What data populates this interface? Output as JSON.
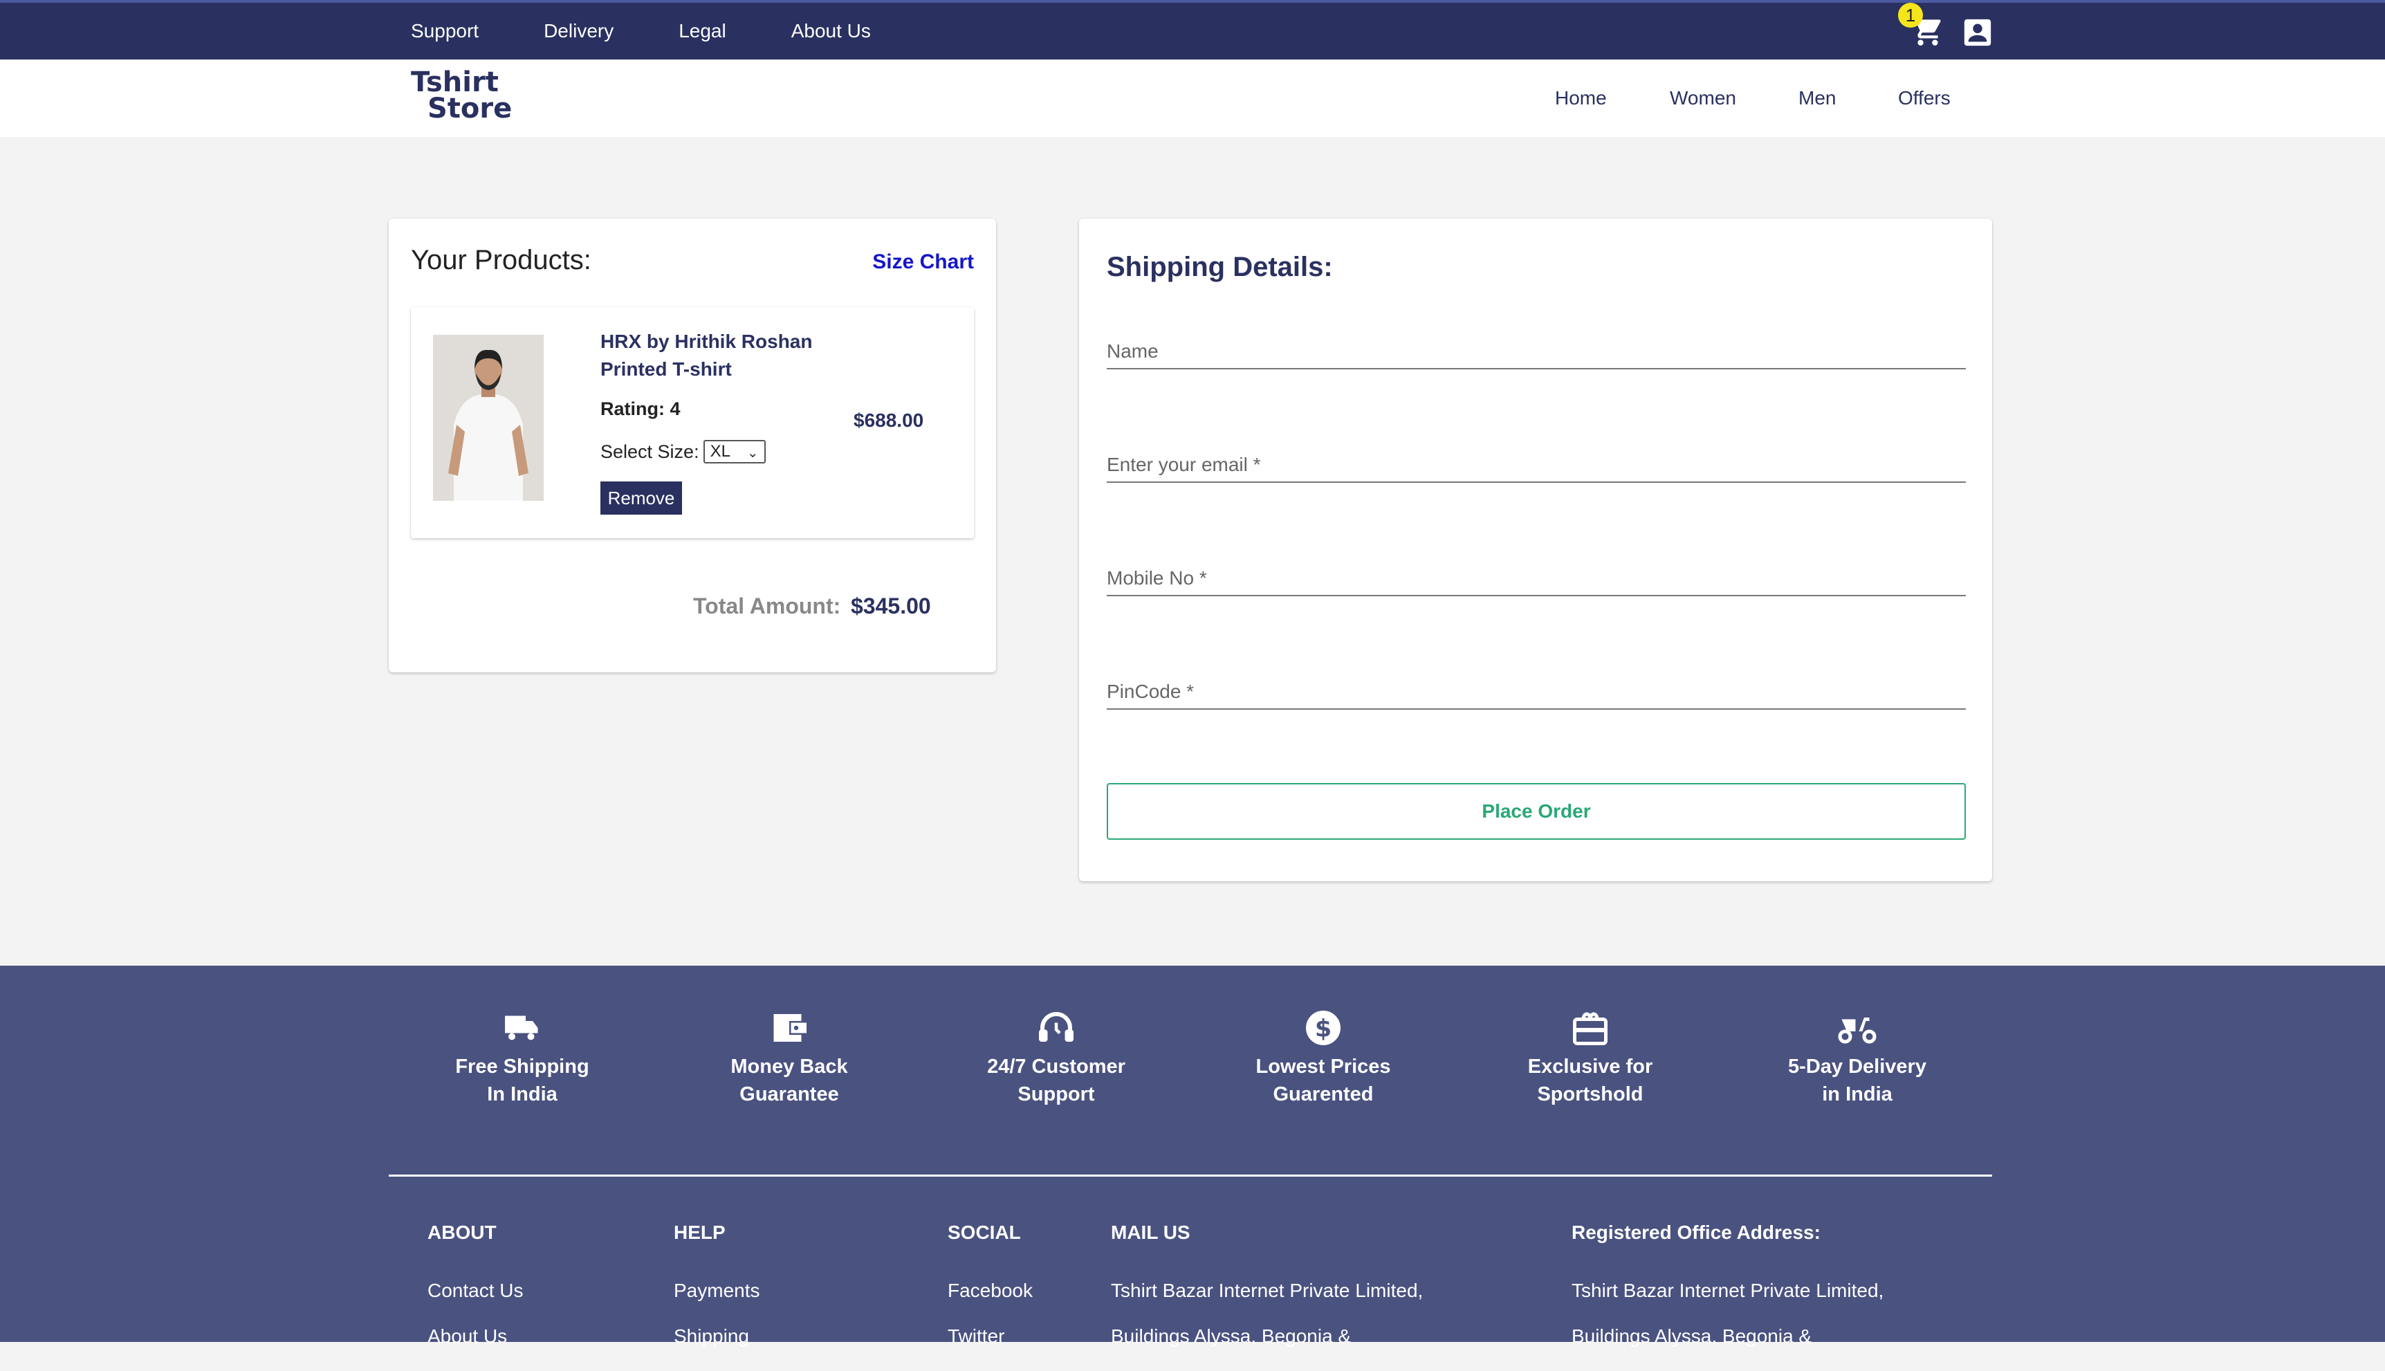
{
  "topbar": {
    "links": [
      "Support",
      "Delivery",
      "Legal",
      "About Us"
    ],
    "cart_count": "1",
    "cart_icon": "cart-icon",
    "account_icon": "account-icon"
  },
  "navbar": {
    "logo_line1": "Tshirt",
    "logo_line2": "Store",
    "links": [
      "Home",
      "Women",
      "Men",
      "Offers"
    ]
  },
  "products": {
    "title": "Your Products:",
    "size_chart": "Size Chart",
    "items": [
      {
        "name": "HRX by Hrithik Roshan Printed T-shirt",
        "rating_label": "Rating: 4",
        "size_label": "Select Size:",
        "size_value": "XL",
        "remove_label": "Remove",
        "price": "$688.00"
      }
    ],
    "total_label": "Total Amount:",
    "total_value": "$345.00"
  },
  "shipping": {
    "title": "Shipping Details:",
    "fields": [
      {
        "placeholder": "Name"
      },
      {
        "placeholder": "Enter your email *"
      },
      {
        "placeholder": "Mobile No *"
      },
      {
        "placeholder": "PinCode *"
      }
    ],
    "place_order": "Place Order"
  },
  "footer": {
    "features": [
      {
        "icon": "truck-icon",
        "line1": "Free Shipping",
        "line2": "In India"
      },
      {
        "icon": "wallet-icon",
        "line1": "Money Back",
        "line2": "Guarantee"
      },
      {
        "icon": "headset-icon",
        "line1": "24/7 Customer",
        "line2": "Support"
      },
      {
        "icon": "dollar-icon",
        "line1": "Lowest Prices",
        "line2": "Guarented"
      },
      {
        "icon": "card-icon",
        "line1": "Exclusive for",
        "line2": "Sportshold"
      },
      {
        "icon": "scooter-icon",
        "line1": "5-Day Delivery",
        "line2": "in India"
      }
    ],
    "columns": {
      "about": {
        "heading": "ABOUT",
        "items": [
          "Contact Us",
          "About Us"
        ]
      },
      "help": {
        "heading": "HELP",
        "items": [
          "Payments",
          "Shipping"
        ]
      },
      "social": {
        "heading": "SOCIAL",
        "items": [
          "Facebook",
          "Twitter"
        ]
      },
      "mail": {
        "heading": "MAIL US",
        "items": [
          "Tshirt Bazar Internet Private Limited,",
          "Buildings Alyssa, Begonia &"
        ]
      },
      "office": {
        "heading": "Registered Office Address:",
        "items": [
          "Tshirt Bazar Internet Private Limited,",
          "Buildings Alyssa, Begonia &"
        ]
      }
    }
  },
  "colors": {
    "topbar": "#2a3160",
    "footer": "#4a5280",
    "accent_green": "#2aa876",
    "link_blue": "#1515c8",
    "badge": "#f6e51a"
  }
}
